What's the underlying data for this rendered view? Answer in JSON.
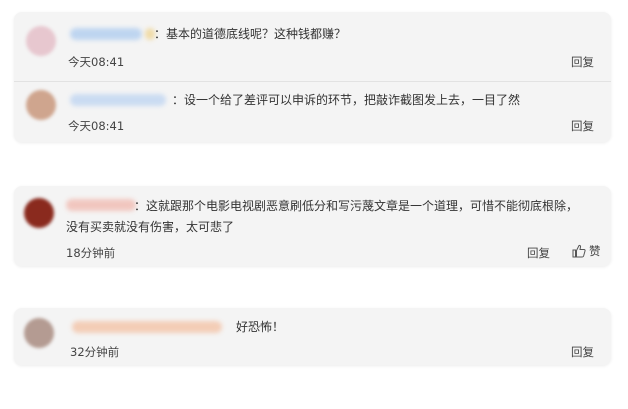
{
  "comments": [
    {
      "text": "：基本的道德底线呢？这种钱都赚？",
      "time": "今天08:41",
      "reply_label": "回复",
      "avatar_color": "#e7c7cf",
      "name_blur_color": "#b9d2f0"
    },
    {
      "text": "：设一个给了差评可以申诉的环节，把敲诈截图发上去，一目了然",
      "time": "今天08:41",
      "reply_label": "回复",
      "avatar_color": "#cfa58e",
      "name_blur_color": "#c6d9f2"
    },
    {
      "text_line1": "：这就跟那个电影电视剧恶意刷低分和写污蔑文章是一个道理，可惜不能彻底根除，",
      "text_line2": "没有买卖就没有伤害，太可悲了",
      "time": "18分钟前",
      "reply_label": "回复",
      "like_label": "赞",
      "avatar_color": "#8a2a1e",
      "name_blur_color": "#f1c2ba"
    },
    {
      "text": "好恐怖！",
      "time": "32分钟前",
      "reply_label": "回复",
      "avatar_color": "#b49b92",
      "name_blur_color": "#f3c9b0"
    }
  ]
}
